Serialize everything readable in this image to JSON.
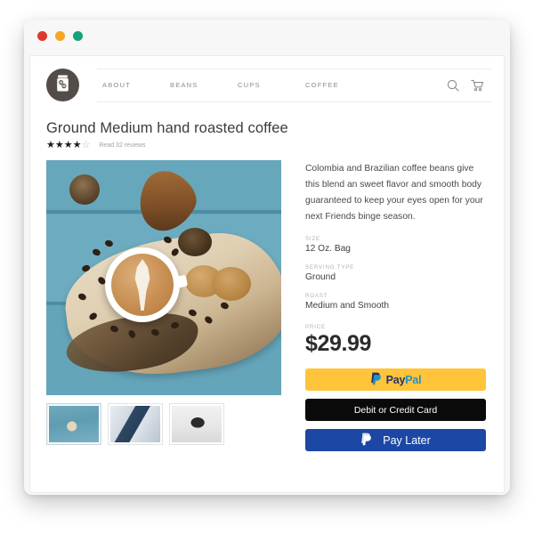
{
  "window": {
    "traffic_lights": [
      {
        "name": "close",
        "color": "#e0382e"
      },
      {
        "name": "minimize",
        "color": "#f5a623"
      },
      {
        "name": "maximize",
        "color": "#1aa179"
      }
    ]
  },
  "site": {
    "logo_icon": "coffee-jar-icon",
    "nav": [
      {
        "label": "ABOUT"
      },
      {
        "label": "BEANS"
      },
      {
        "label": "CUPS"
      },
      {
        "label": "COFFEE"
      }
    ],
    "actions": [
      {
        "icon": "search-icon"
      },
      {
        "icon": "shopping-cart-icon"
      }
    ]
  },
  "product": {
    "title": "Ground Medium hand roasted coffee",
    "rating": {
      "stars_filled": 4,
      "stars_total": 5,
      "filled_glyph": "★",
      "empty_glyph": "☆",
      "reviews_label": "Read 32 reviews"
    },
    "description": "Colombia and Brazilian coffee beans give this blend an sweet flavor and smooth body guaranteed to keep your eyes open for your next Friends binge season.",
    "attributes": [
      {
        "label": "SIZE",
        "value": "12 Oz. Bag"
      },
      {
        "label": "SERVING TYPE",
        "value": "Ground"
      },
      {
        "label": "ROAST",
        "value": "Medium and Smooth"
      }
    ],
    "price": {
      "label": "PRICE",
      "value": "$29.99"
    },
    "gallery": {
      "main_alt": "latte-art-cup-on-wooden-board",
      "thumbnails": [
        {
          "alt": "latte-art-cup-on-wooden-board",
          "selected": true
        },
        {
          "alt": "blue-mug-pouring-coffee",
          "selected": false
        },
        {
          "alt": "glass-cup-black-coffee-with-beans",
          "selected": false
        }
      ]
    }
  },
  "checkout": {
    "buttons": [
      {
        "id": "paypal",
        "label_pay": "Pay",
        "label_pal": "Pal",
        "bg": "#ffc439"
      },
      {
        "id": "debit-credit",
        "label": "Debit or Credit Card",
        "bg": "#0a0a0a"
      },
      {
        "id": "pay-later",
        "label": "Pay Later",
        "bg": "#1c47a4"
      }
    ]
  }
}
